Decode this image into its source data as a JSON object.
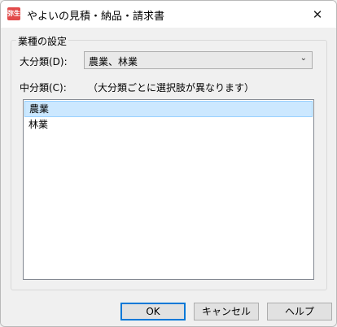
{
  "window": {
    "title": "やよいの見積・納品・請求書",
    "app_icon_text": "弥生"
  },
  "group": {
    "legend": "業種の設定",
    "major_label": "大分類(D):",
    "major_value": "農業、林業",
    "minor_label": "中分類(C):",
    "note": "（大分類ごとに選択肢が異なります）",
    "items": [
      "農業",
      "林業"
    ],
    "selected_index": 0
  },
  "buttons": {
    "ok": "OK",
    "cancel": "キャンセル",
    "help": "ヘルプ"
  },
  "icons": {
    "close": "close-icon",
    "dropdown": "chevron-down-icon",
    "app": "yayoi-app-icon"
  }
}
